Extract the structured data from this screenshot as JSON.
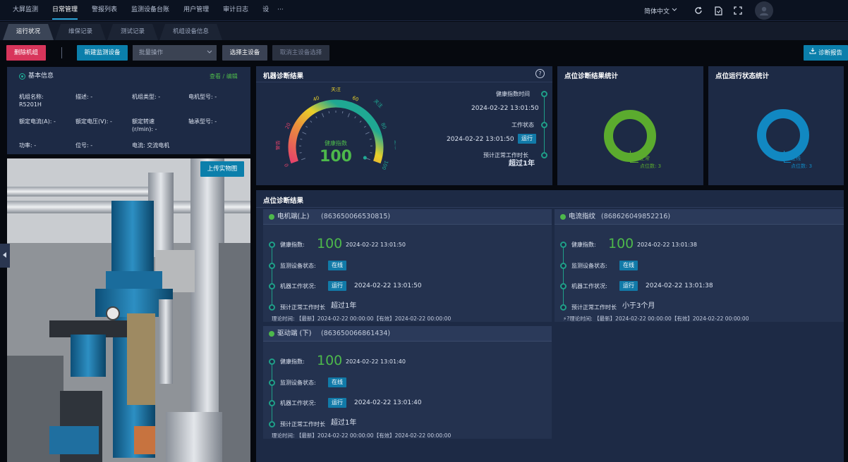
{
  "nav": {
    "items": [
      "大屏监测",
      "日常管理",
      "警报列表",
      "监测设备台账",
      "用户管理",
      "审计日志",
      "设"
    ],
    "more": "···",
    "lang": "简体中文",
    "colors": {
      "accent": "#2aa3d8",
      "panel": "#1d2a45",
      "green": "#4db84b",
      "red": "#d8355b",
      "blue": "#0b7fab"
    }
  },
  "tabs": [
    "运行状况",
    "维保记录",
    "测试记录",
    "机组设备信息"
  ],
  "toolbar": {
    "delete": "删除机组",
    "new_device": "新建监测设备",
    "batch": "批量操作",
    "choose_main": "选择主设备",
    "cancel_main": "取消主设备选择",
    "report": "诊断报告"
  },
  "basic": {
    "title": "基本信息",
    "edit": "查看 / 编辑",
    "fields": [
      {
        "label": "机组名称:",
        "value": "R5201H"
      },
      {
        "label": "描述:",
        "value": "-"
      },
      {
        "label": "机组类型:",
        "value": "-"
      },
      {
        "label": "电机型号:",
        "value": "-"
      },
      {
        "label": "额定电流(A):",
        "value": "-"
      },
      {
        "label": "额定电压(V):",
        "value": "-"
      },
      {
        "label": "额定转速",
        "label2": "(r/min):",
        "value": "-"
      },
      {
        "label": "轴承型号:",
        "value": "-"
      },
      {
        "label": "功率:",
        "value": "-"
      },
      {
        "label": "位号:",
        "value": "-"
      },
      {
        "label": "电流:",
        "value": "交流电机"
      }
    ]
  },
  "photo": {
    "upload": "上传实物图"
  },
  "diag": {
    "title": "机器诊断结果",
    "help": "?",
    "gauge": {
      "value": 100,
      "min": 0,
      "max": 100,
      "center_label": "健康指数",
      "ticks": [
        "0",
        "20",
        "40",
        "60",
        "80",
        "100"
      ],
      "zones": [
        {
          "label": "注意警告",
          "from": 0,
          "to": 20,
          "color": "#e6426a"
        },
        {
          "label": "重点关注",
          "from": 40,
          "to": 60,
          "color": "#e8d02a"
        },
        {
          "label": "关注",
          "from": 60,
          "to": 80,
          "color": "#1fa893"
        },
        {
          "label": "正常",
          "from": 80,
          "to": 100,
          "color": "#1fa893"
        }
      ]
    },
    "health_time_label": "健康指数时间",
    "health_time": "2024-02-22 13:01:50",
    "work_state_label": "工作状态",
    "work_state_time": "2024-02-22 13:01:50",
    "work_state_badge": "运行",
    "expected_label": "预计正常工作时长",
    "expected_value": "超过1年"
  },
  "point_stats": {
    "title": "点位诊断结果统计",
    "legend_name": "正常",
    "legend_count": "点位数: 3",
    "value": 3,
    "color": "#5bab2e"
  },
  "run_stats": {
    "title": "点位运行状态统计",
    "legend_name": "在线",
    "legend_count": "点位数: 3",
    "value": 3,
    "color": "#1188c2"
  },
  "points": {
    "title": "点位诊断结果",
    "health_label": "健康指数:",
    "device_state_label": "监测设备状态:",
    "work_label": "机器工作状况:",
    "expected_label": "预计正常工作时长",
    "theory_label": "理论时间:",
    "items": [
      {
        "name": "电机端(上)",
        "id": "(863650066530815)",
        "health": "100",
        "health_time": "2024-02-22 13:01:50",
        "device_state": "在线",
        "work_badge": "运行",
        "work_time": "2024-02-22 13:01:50",
        "expected": "超过1年",
        "theory_prefix": "",
        "theory": "【最新】2024-02-22 00:00:00【有效】2024-02-22 00:00:00"
      },
      {
        "name": "电流指纹",
        "id": "(868626049852216)",
        "health": "100",
        "health_time": "2024-02-22 13:01:38",
        "device_state": "在线",
        "work_badge": "运行",
        "work_time": "2024-02-22 13:01:38",
        "expected": "小于3个月",
        "theory_prefix": "⚡?",
        "theory": "【最新】2024-02-22 00:00:00【有效】2024-02-22 00:00:00"
      },
      {
        "name": "驱动端 (下)",
        "id": "(863650066861434)",
        "health": "100",
        "health_time": "2024-02-22 13:01:40",
        "device_state": "在线",
        "work_badge": "运行",
        "work_time": "2024-02-22 13:01:40",
        "expected": "超过1年",
        "theory_prefix": "",
        "theory": "【最新】2024-02-22 00:00:00【有效】2024-02-22 00:00:00"
      }
    ]
  }
}
